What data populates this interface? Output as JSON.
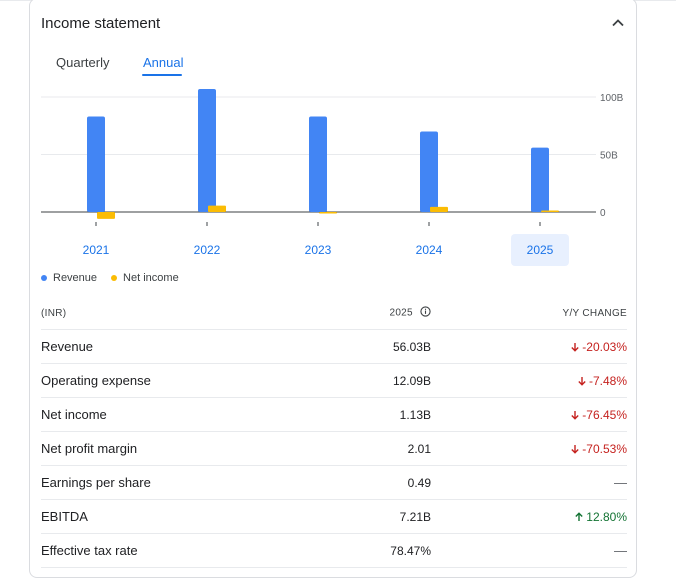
{
  "card": {
    "title": "Income statement",
    "collapse_icon": "chevron-up-icon"
  },
  "tabs": [
    {
      "label": "Quarterly",
      "active": false
    },
    {
      "label": "Annual",
      "active": true
    }
  ],
  "chart_data": {
    "type": "bar",
    "categories": [
      "2021",
      "2022",
      "2023",
      "2024",
      "2025"
    ],
    "selected_category": "2025",
    "series": [
      {
        "name": "Revenue",
        "color": "#4285f4",
        "values": [
          83,
          107,
          83,
          70,
          56.03
        ]
      },
      {
        "name": "Net income",
        "color": "#fbbc04",
        "values": [
          -6,
          5.5,
          -0.5,
          4.5,
          1.13
        ]
      }
    ],
    "yticks": [
      "100B",
      "50B",
      "0"
    ],
    "ylim": [
      -10,
      100
    ],
    "grid": true,
    "legend_position": "bottom-left"
  },
  "table": {
    "headers": {
      "label": "(INR)",
      "year": "2025",
      "change": "Y/Y CHANGE"
    },
    "rows": [
      {
        "label": "Revenue",
        "value": "56.03B",
        "change": "-20.03%",
        "dir": "down"
      },
      {
        "label": "Operating expense",
        "value": "12.09B",
        "change": "-7.48%",
        "dir": "down"
      },
      {
        "label": "Net income",
        "value": "1.13B",
        "change": "-76.45%",
        "dir": "down"
      },
      {
        "label": "Net profit margin",
        "value": "2.01",
        "change": "-70.53%",
        "dir": "down"
      },
      {
        "label": "Earnings per share",
        "value": "0.49",
        "change": "—",
        "dir": "none"
      },
      {
        "label": "EBITDA",
        "value": "7.21B",
        "change": "12.80%",
        "dir": "up"
      },
      {
        "label": "Effective tax rate",
        "value": "78.47%",
        "change": "—",
        "dir": "none"
      }
    ]
  }
}
